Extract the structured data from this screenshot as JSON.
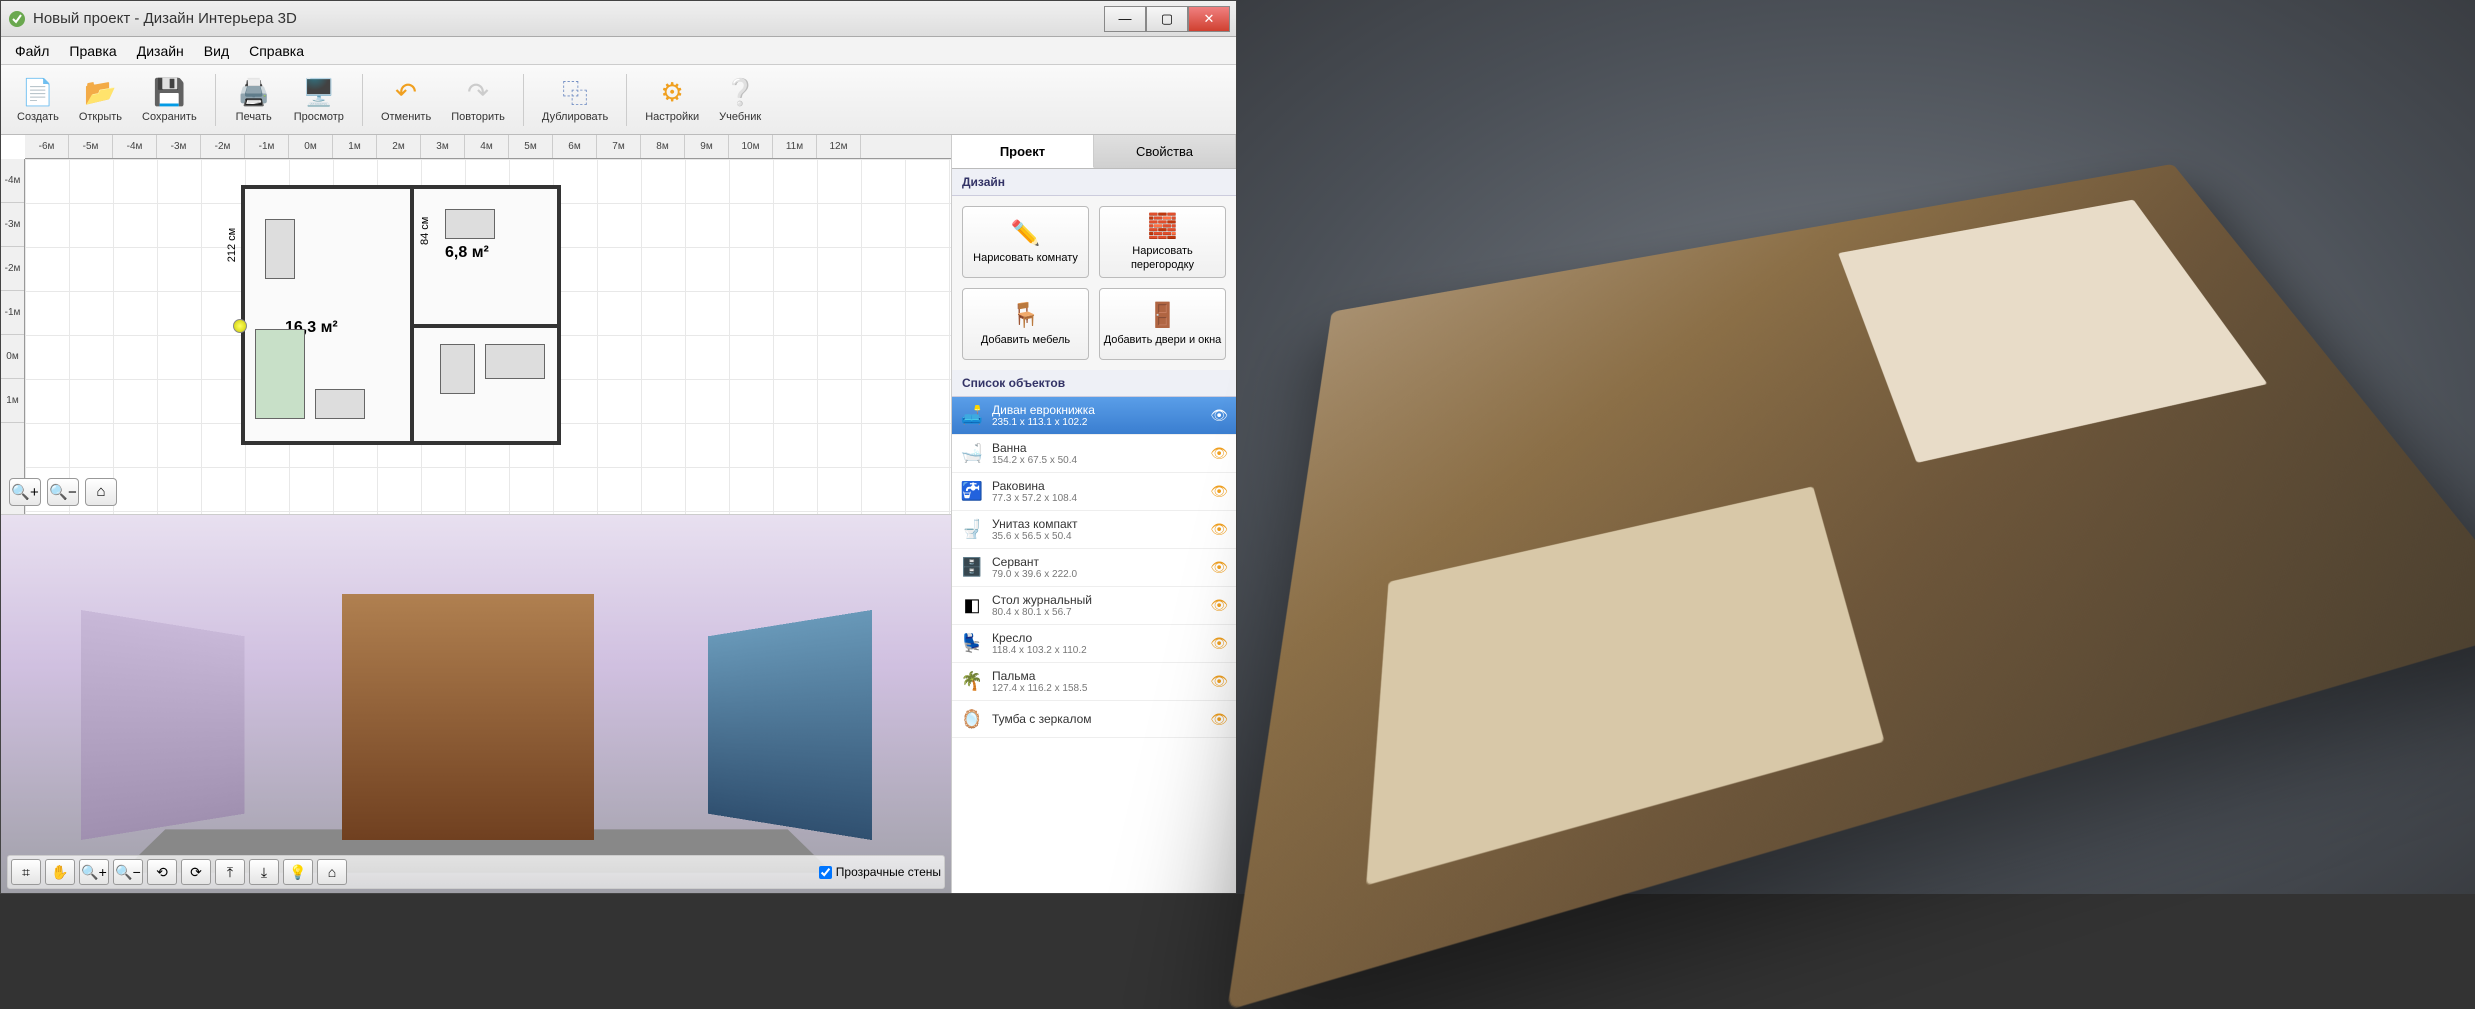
{
  "window": {
    "title": "Новый проект - Дизайн Интерьера 3D"
  },
  "menubar": [
    "Файл",
    "Правка",
    "Дизайн",
    "Вид",
    "Справка"
  ],
  "toolbar": [
    {
      "label": "Создать",
      "icon": "📄",
      "color": "#4a90d8"
    },
    {
      "label": "Открыть",
      "icon": "📂",
      "color": "#f0b040"
    },
    {
      "label": "Сохранить",
      "icon": "💾",
      "color": "#5060c0"
    },
    {
      "sep": true
    },
    {
      "label": "Печать",
      "icon": "🖨️",
      "color": "#888"
    },
    {
      "label": "Просмотр",
      "icon": "🖥️",
      "color": "#4a90d8"
    },
    {
      "sep": true
    },
    {
      "label": "Отменить",
      "icon": "↶",
      "color": "#f0a020"
    },
    {
      "label": "Повторить",
      "icon": "↷",
      "color": "#ccc"
    },
    {
      "sep": true
    },
    {
      "label": "Дублировать",
      "icon": "⿻",
      "color": "#6a88c0"
    },
    {
      "sep": true
    },
    {
      "label": "Настройки",
      "icon": "⚙",
      "color": "#f0a020"
    },
    {
      "label": "Учебник",
      "icon": "❔",
      "color": "#4a90d8"
    }
  ],
  "ruler_h": [
    "-6м",
    "-5м",
    "-4м",
    "-3м",
    "-2м",
    "-1м",
    "0м",
    "1м",
    "2м",
    "3м",
    "4м",
    "5м",
    "6м",
    "7м",
    "8м",
    "9м",
    "10м",
    "11м",
    "12м"
  ],
  "ruler_v": [
    "-4м",
    "-3м",
    "-2м",
    "-1м",
    "0м",
    "1м"
  ],
  "plan": {
    "room1": "16,3 м²",
    "room2": "6,8 м²",
    "dim1": "212 см",
    "dim2": "84 см"
  },
  "plan_controls": [
    {
      "name": "zoom-in-icon",
      "glyph": "🔍+"
    },
    {
      "name": "zoom-out-icon",
      "glyph": "🔍−"
    },
    {
      "name": "home-icon",
      "glyph": "⌂"
    }
  ],
  "bottom_controls": [
    {
      "name": "wireframe-icon",
      "glyph": "⌗"
    },
    {
      "name": "pan-icon",
      "glyph": "✋"
    },
    {
      "name": "zoom-in-icon",
      "glyph": "🔍+"
    },
    {
      "name": "zoom-out-icon",
      "glyph": "🔍−"
    },
    {
      "name": "rotate-left-icon",
      "glyph": "⟲"
    },
    {
      "name": "rotate-right-icon",
      "glyph": "⟳"
    },
    {
      "name": "clip-forward-icon",
      "glyph": "⤒"
    },
    {
      "name": "clip-back-icon",
      "glyph": "⤓"
    },
    {
      "name": "light-icon",
      "glyph": "💡"
    },
    {
      "name": "home-icon",
      "glyph": "⌂"
    }
  ],
  "transparent_walls": "Прозрачные стены",
  "tabs": {
    "project": "Проект",
    "properties": "Свойства"
  },
  "sections": {
    "design": "Дизайн",
    "objects": "Список объектов"
  },
  "design_buttons": [
    {
      "label": "Нарисовать\nкомнату",
      "icon": "✏️"
    },
    {
      "label": "Нарисовать\nперегородку",
      "icon": "🧱"
    },
    {
      "label": "Добавить\nмебель",
      "icon": "🪑"
    },
    {
      "label": "Добавить\nдвери и окна",
      "icon": "🚪"
    }
  ],
  "objects": [
    {
      "name": "Диван еврокнижка",
      "dim": "235.1 x 113.1 x 102.2",
      "icon": "🛋️",
      "selected": true
    },
    {
      "name": "Ванна",
      "dim": "154.2 x 67.5 x 50.4",
      "icon": "🛁"
    },
    {
      "name": "Раковина",
      "dim": "77.3 x 57.2 x 108.4",
      "icon": "🚰"
    },
    {
      "name": "Унитаз компакт",
      "dim": "35.6 x 56.5 x 50.4",
      "icon": "🚽"
    },
    {
      "name": "Сервант",
      "dim": "79.0 x 39.6 x 222.0",
      "icon": "🗄️"
    },
    {
      "name": "Стол журнальный",
      "dim": "80.4 x 80.1 x 56.7",
      "icon": "◧"
    },
    {
      "name": "Кресло",
      "dim": "118.4 x 103.2 x 110.2",
      "icon": "💺"
    },
    {
      "name": "Пальма",
      "dim": "127.4 x 116.2 x 158.5",
      "icon": "🌴"
    },
    {
      "name": "Тумба с зеркалом",
      "dim": "",
      "icon": "🪞"
    }
  ]
}
